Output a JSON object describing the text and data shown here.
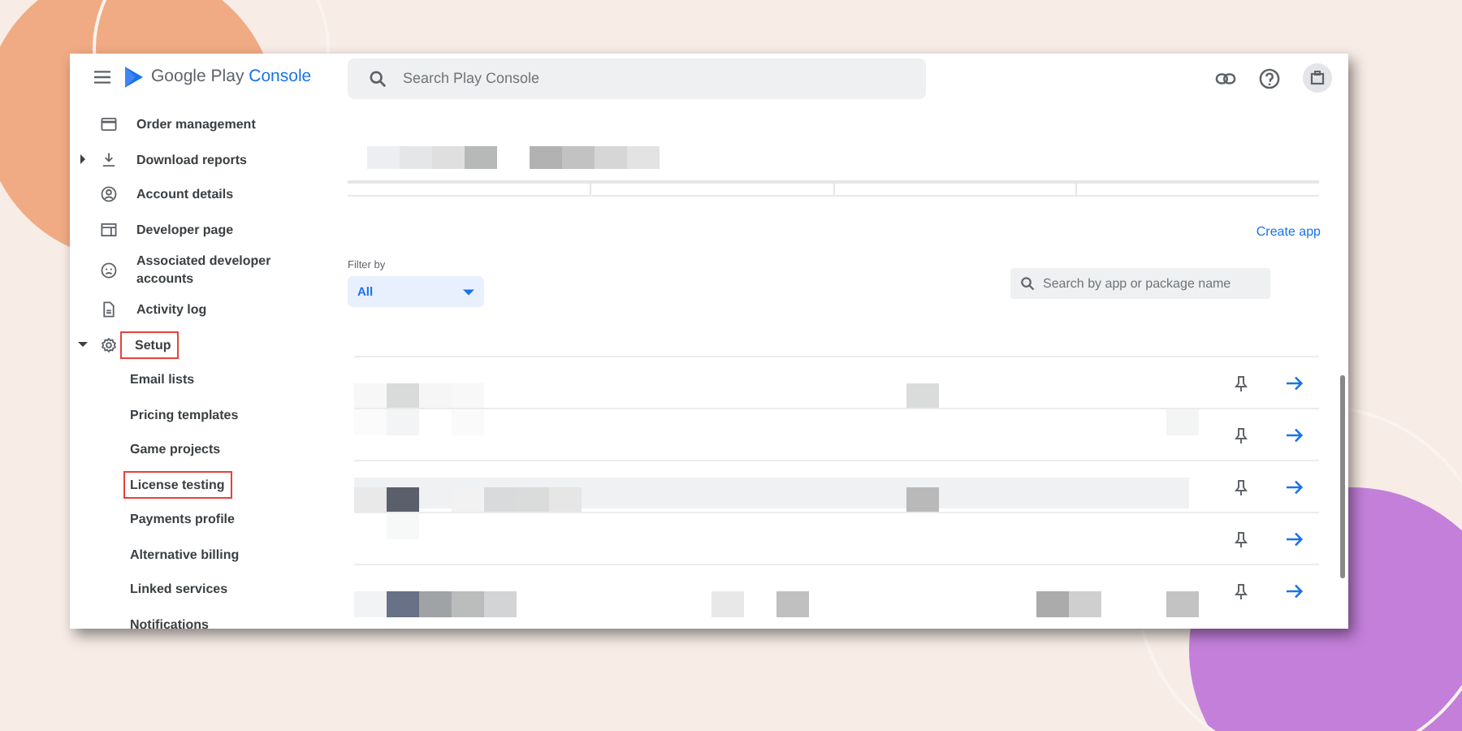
{
  "header": {
    "logo": {
      "brand": "Google Play",
      "product": "Console"
    },
    "search": {
      "placeholder": "Search Play Console"
    }
  },
  "sidebar": {
    "items": [
      {
        "label": "Order management",
        "highlighted": false
      },
      {
        "label": "Download reports",
        "highlighted": false,
        "expanded": false
      },
      {
        "label": "Account details",
        "highlighted": false
      },
      {
        "label": "Developer page",
        "highlighted": false
      },
      {
        "label": "Associated developer accounts",
        "highlighted": false
      },
      {
        "label": "Activity log",
        "highlighted": false
      },
      {
        "label": "Setup",
        "highlighted": true,
        "expanded": true,
        "children": [
          {
            "label": "Email lists",
            "highlighted": false
          },
          {
            "label": "Pricing templates",
            "highlighted": false
          },
          {
            "label": "Game projects",
            "highlighted": false
          },
          {
            "label": "License testing",
            "highlighted": true
          },
          {
            "label": "Payments profile",
            "highlighted": false
          },
          {
            "label": "Alternative billing",
            "highlighted": false
          },
          {
            "label": "Linked services",
            "highlighted": false
          },
          {
            "label": "Notifications",
            "highlighted": false
          }
        ]
      }
    ]
  },
  "main": {
    "create_link": "Create app",
    "filter": {
      "label": "Filter by",
      "value": "All"
    },
    "search": {
      "placeholder": "Search by app or package name"
    },
    "rows": [
      {
        "selected": false
      },
      {
        "selected": false
      },
      {
        "selected": true
      },
      {
        "selected": false
      },
      {
        "selected": false
      }
    ]
  }
}
